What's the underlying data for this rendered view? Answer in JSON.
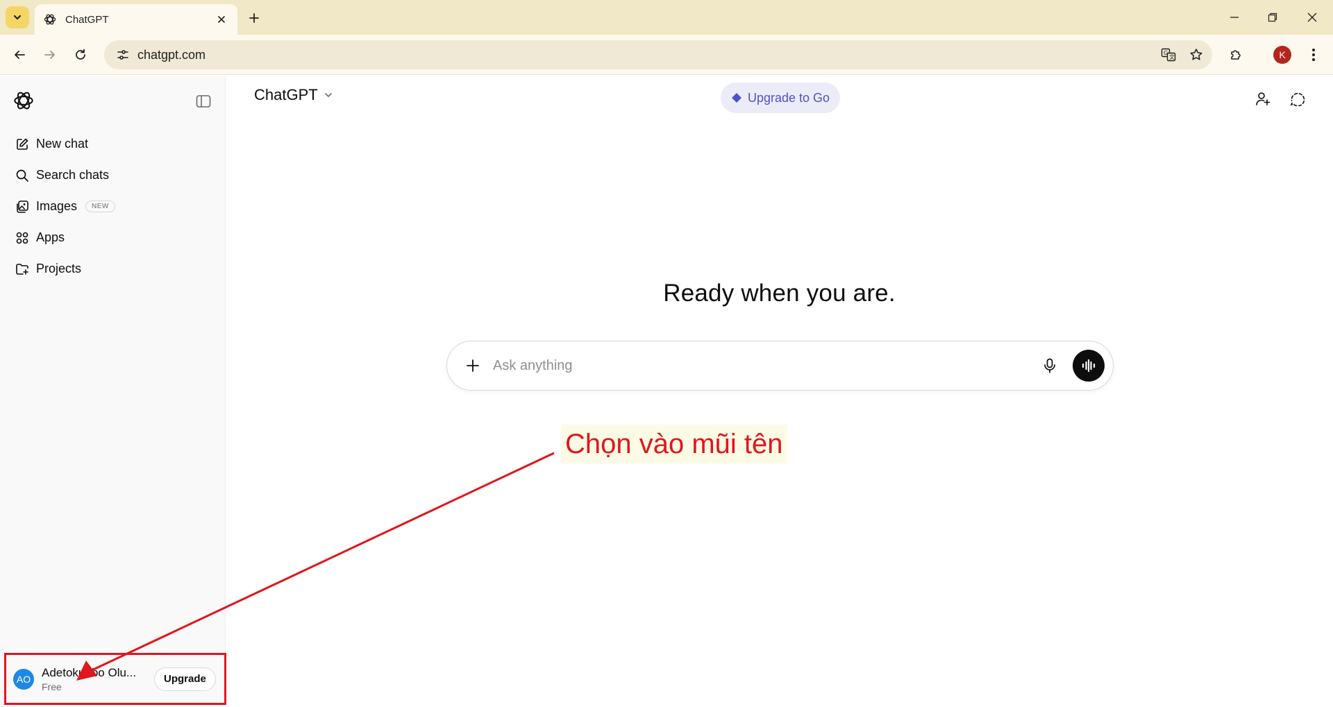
{
  "browser": {
    "tab_title": "ChatGPT",
    "url": "chatgpt.com",
    "profile_initial": "K"
  },
  "sidebar": {
    "items": [
      {
        "label": "New chat",
        "icon": "edit-icon"
      },
      {
        "label": "Search chats",
        "icon": "search-icon"
      },
      {
        "label": "Images",
        "icon": "images-icon",
        "badge": "NEW"
      },
      {
        "label": "Apps",
        "icon": "apps-icon"
      },
      {
        "label": "Projects",
        "icon": "folder-icon"
      }
    ],
    "user": {
      "initials": "AO",
      "name": "Adetokunbo Olu...",
      "plan": "Free",
      "upgrade_label": "Upgrade"
    }
  },
  "header": {
    "model_label": "ChatGPT",
    "upgrade_pill_label": "Upgrade to Go"
  },
  "main": {
    "hero_text": "Ready when you are.",
    "composer_placeholder": "Ask anything"
  },
  "annotation": {
    "text": "Chọn vào mũi tên",
    "color": "#e0161c"
  },
  "colors": {
    "tab_strip": "#f0e8c6",
    "accent_pill": "#5151c8",
    "avatar": "#1e88e5",
    "profile": "#b3261e"
  }
}
